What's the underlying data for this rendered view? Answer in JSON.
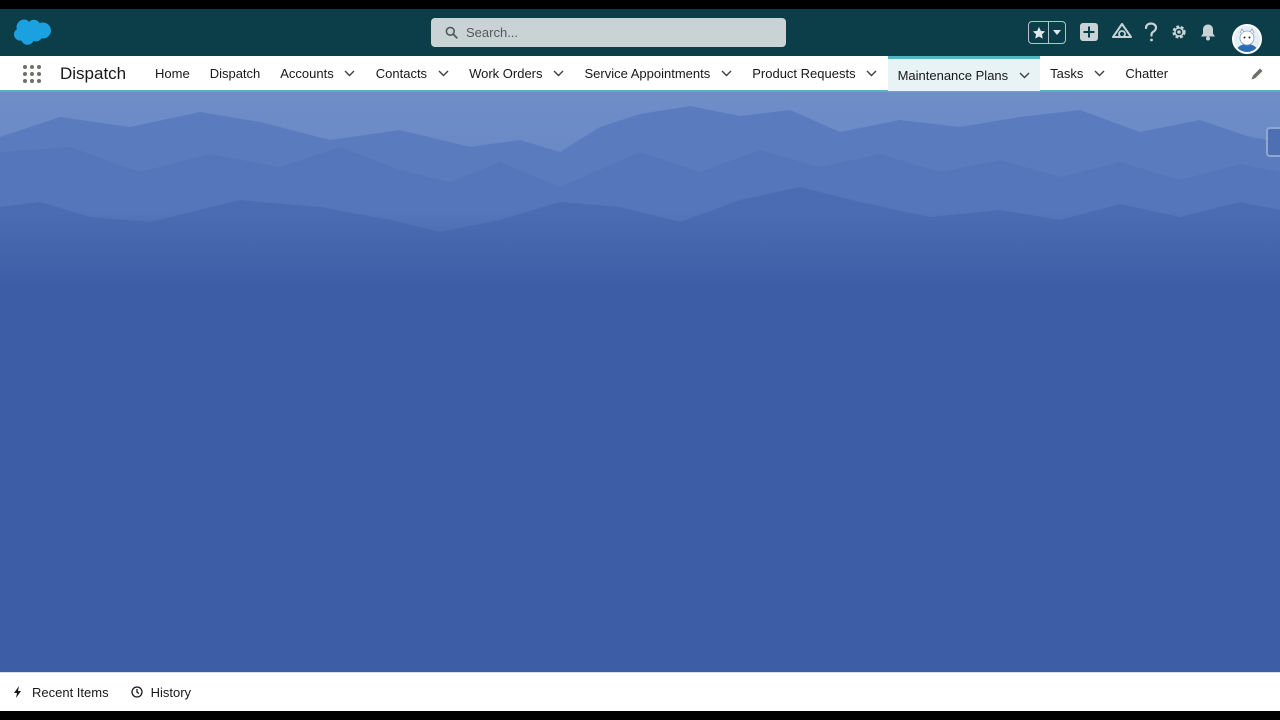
{
  "search": {
    "placeholder": "Search..."
  },
  "app": {
    "name": "Dispatch"
  },
  "nav": {
    "items": [
      {
        "label": "Home",
        "has_menu": false
      },
      {
        "label": "Dispatch",
        "has_menu": false
      },
      {
        "label": "Accounts",
        "has_menu": true
      },
      {
        "label": "Contacts",
        "has_menu": true
      },
      {
        "label": "Work Orders",
        "has_menu": true
      },
      {
        "label": "Service Appointments",
        "has_menu": true
      },
      {
        "label": "Product Requests",
        "has_menu": true
      },
      {
        "label": "Maintenance Plans",
        "has_menu": true,
        "active": true
      },
      {
        "label": "Tasks",
        "has_menu": true
      },
      {
        "label": "Chatter",
        "has_menu": false
      }
    ]
  },
  "header_icons": [
    "favorites-star-icon",
    "favorites-caret-icon",
    "global-add-icon",
    "trailhead-icon",
    "help-icon",
    "setup-gear-icon",
    "notifications-bell-icon",
    "avatar"
  ],
  "utility": {
    "items": [
      {
        "label": "Recent Items",
        "icon": "lightning-bolt-icon"
      },
      {
        "label": "History",
        "icon": "clock-icon"
      }
    ]
  },
  "colors": {
    "header_bg": "#0b3e48",
    "nav_accent": "#59b3c7",
    "background": "#3d5da6",
    "brand_cloud": "#1ba0e0"
  }
}
